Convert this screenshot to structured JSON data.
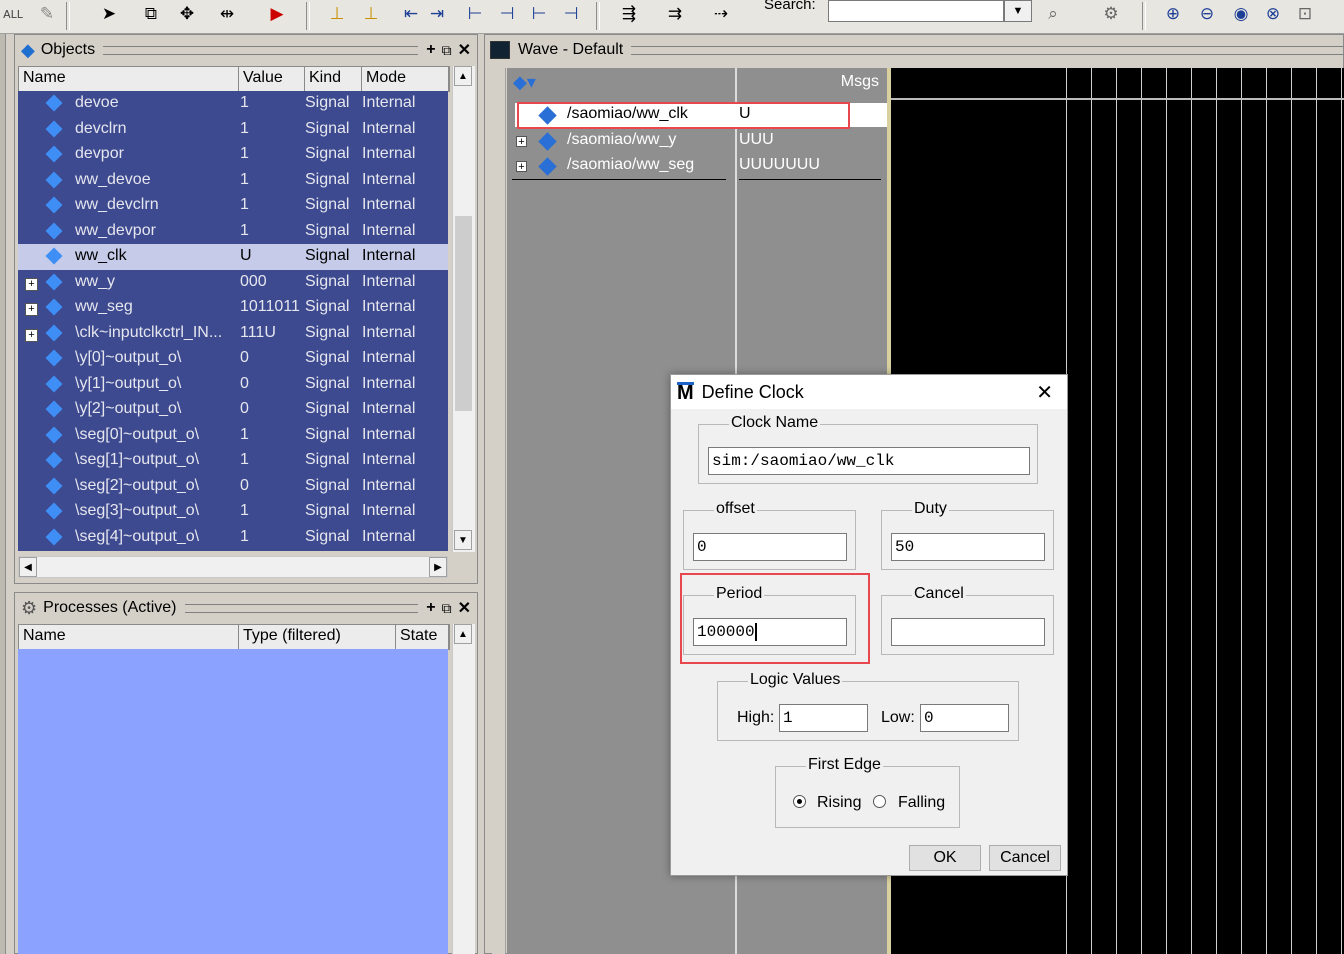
{
  "toolbar": {
    "search_label": "Search:",
    "search_value": ""
  },
  "objects_pane": {
    "title": "Objects",
    "columns": [
      "Name",
      "Value",
      "Kind",
      "Mode"
    ],
    "rows": [
      {
        "name": "devoe",
        "value": "1",
        "kind": "Signal",
        "mode": "Internal",
        "expandable": false,
        "selected": false
      },
      {
        "name": "devclrn",
        "value": "1",
        "kind": "Signal",
        "mode": "Internal",
        "expandable": false,
        "selected": false
      },
      {
        "name": "devpor",
        "value": "1",
        "kind": "Signal",
        "mode": "Internal",
        "expandable": false,
        "selected": false
      },
      {
        "name": "ww_devoe",
        "value": "1",
        "kind": "Signal",
        "mode": "Internal",
        "expandable": false,
        "selected": false
      },
      {
        "name": "ww_devclrn",
        "value": "1",
        "kind": "Signal",
        "mode": "Internal",
        "expandable": false,
        "selected": false
      },
      {
        "name": "ww_devpor",
        "value": "1",
        "kind": "Signal",
        "mode": "Internal",
        "expandable": false,
        "selected": false
      },
      {
        "name": "ww_clk",
        "value": "U",
        "kind": "Signal",
        "mode": "Internal",
        "expandable": false,
        "selected": true
      },
      {
        "name": "ww_y",
        "value": "000",
        "kind": "Signal",
        "mode": "Internal",
        "expandable": true,
        "selected": false
      },
      {
        "name": "ww_seg",
        "value": "1011011",
        "kind": "Signal",
        "mode": "Internal",
        "expandable": true,
        "selected": false
      },
      {
        "name": "\\clk~inputclkctrl_IN...",
        "value": "111U",
        "kind": "Signal",
        "mode": "Internal",
        "expandable": true,
        "selected": false
      },
      {
        "name": "\\y[0]~output_o\\",
        "value": "0",
        "kind": "Signal",
        "mode": "Internal",
        "expandable": false,
        "selected": false
      },
      {
        "name": "\\y[1]~output_o\\",
        "value": "0",
        "kind": "Signal",
        "mode": "Internal",
        "expandable": false,
        "selected": false
      },
      {
        "name": "\\y[2]~output_o\\",
        "value": "0",
        "kind": "Signal",
        "mode": "Internal",
        "expandable": false,
        "selected": false
      },
      {
        "name": "\\seg[0]~output_o\\",
        "value": "1",
        "kind": "Signal",
        "mode": "Internal",
        "expandable": false,
        "selected": false
      },
      {
        "name": "\\seg[1]~output_o\\",
        "value": "1",
        "kind": "Signal",
        "mode": "Internal",
        "expandable": false,
        "selected": false
      },
      {
        "name": "\\seg[2]~output_o\\",
        "value": "0",
        "kind": "Signal",
        "mode": "Internal",
        "expandable": false,
        "selected": false
      },
      {
        "name": "\\seg[3]~output_o\\",
        "value": "1",
        "kind": "Signal",
        "mode": "Internal",
        "expandable": false,
        "selected": false
      },
      {
        "name": "\\seg[4]~output_o\\",
        "value": "1",
        "kind": "Signal",
        "mode": "Internal",
        "expandable": false,
        "selected": false
      }
    ]
  },
  "processes_pane": {
    "title": "Processes (Active)",
    "columns": [
      "Name",
      "Type (filtered)",
      "State"
    ]
  },
  "wave_pane": {
    "title": "Wave - Default",
    "msgs_label": "Msgs",
    "signals": [
      {
        "name": "/saomiao/ww_clk",
        "value": "U",
        "expandable": false
      },
      {
        "name": "/saomiao/ww_y",
        "value": "UUU",
        "expandable": true
      },
      {
        "name": "/saomiao/ww_seg",
        "value": "UUUUUUU",
        "expandable": true
      }
    ]
  },
  "define_clock_dialog": {
    "title": "Define Clock",
    "close_label": "✕",
    "clock_name_label": "Clock Name",
    "clock_name_value": "sim:/saomiao/ww_clk",
    "offset_label": "offset",
    "offset_value": "0",
    "duty_label": "Duty",
    "duty_value": "50",
    "period_label": "Period",
    "period_value": "100000",
    "cancel_group_label": "Cancel",
    "cancel_value": "",
    "logic_values_label": "Logic Values",
    "high_label": "High:",
    "high_value": "1",
    "low_label": "Low:",
    "low_value": "0",
    "first_edge_label": "First Edge",
    "rising_label": "Rising",
    "falling_label": "Falling",
    "first_edge_selected": "Rising",
    "ok_label": "OK",
    "cancel_label": "Cancel"
  },
  "colors": {
    "object_list_bg": "#3d4a90",
    "process_list_bg": "#8ba2ff",
    "highlight_box": "#e8474d",
    "wave_bg": "#000000",
    "signal_icon": "#3f8ef5"
  }
}
